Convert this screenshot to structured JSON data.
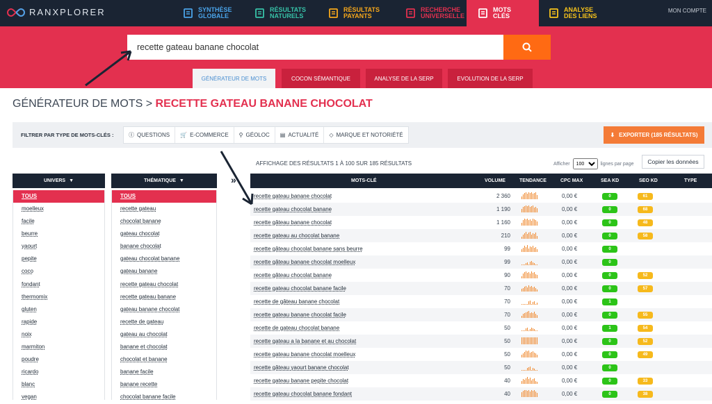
{
  "brand": {
    "name": "RANXPLORER"
  },
  "nav": [
    {
      "label1": "SYNTHÈSE",
      "label2": "GLOBALE",
      "color": "#4aa3e8",
      "icon": "report-icon"
    },
    {
      "label1": "RÉSULTATS",
      "label2": "NATURELS",
      "color": "#37c2a8",
      "icon": "list-icon"
    },
    {
      "label1": "RÉSULTATS",
      "label2": "PAYANTS",
      "color": "#f7a81b",
      "icon": "ad-icon"
    },
    {
      "label1": "RECHERCHE",
      "label2": "UNIVERSELLE",
      "color": "#e3304f",
      "icon": "search-doc-icon"
    },
    {
      "label1": "MOTS",
      "label2": "CLÉS",
      "color": "#ffffff",
      "icon": "key-search-icon",
      "active": true
    },
    {
      "label1": "ANALYSE",
      "label2": "DES LIENS",
      "color": "#f7c31b",
      "icon": "link-icon"
    }
  ],
  "account": "MON COMPTE",
  "search": {
    "value": "recette gateau banane chocolat"
  },
  "tabs": [
    "GÉNÉRATEUR DE MOTS",
    "COCON SÉMANTIQUE",
    "ANALYSE DE LA SERP",
    "EVOLUTION DE LA SERP"
  ],
  "breadcrumb": {
    "root": "GÉNÉRATEUR DE MOTS",
    "separator": " > ",
    "current": "RECETTE GATEAU BANANE CHOCOLAT"
  },
  "filters": {
    "label": "FILTRER PAR TYPE DE MOTS-CLÉS :",
    "chips": [
      "QUESTIONS",
      "E-COMMERCE",
      "GÉOLOC",
      "ACTUALITÉ",
      "MARQUE ET NOTORIÉTÉ"
    ]
  },
  "export_label": "EXPORTER (185 RÉSULTATS)",
  "results_info": "AFFICHAGE DES RÉSULTATS 1 À 100 SUR 185 RÉSULTATS",
  "perpage": {
    "prefix": "Afficher",
    "value": "100",
    "suffix": "lignes par page"
  },
  "copy_label": "Copier les données",
  "univers": {
    "title": "UNIVERS",
    "selected": "TOUS",
    "items": [
      "moelleux",
      "facile",
      "beurre",
      "yaourt",
      "pepite",
      "coco",
      "fondant",
      "thermomix",
      "gluten",
      "rapide",
      "noix",
      "marmiton",
      "poudre",
      "ricardo",
      "blanc",
      "vegan"
    ]
  },
  "thematique": {
    "title": "THÉMATIQUE",
    "selected": "TOUS",
    "items": [
      "recette gateau",
      "chocolat banane",
      "gateau chocolat",
      "banane chocolat",
      "gateau chocolat banane",
      "gateau banane",
      "recette gateau chocolat",
      "recette gateau banane",
      "gateau banane chocolat",
      "recette de gateau",
      "gateau au chocolat",
      "banane et chocolat",
      "chocolat et banane",
      "banane facile",
      "banane recette",
      "chocolat banane facile"
    ]
  },
  "table": {
    "headers": {
      "kw": "MOTS-CLÉ",
      "vol": "VOLUME",
      "trend": "TENDANCE",
      "cpc": "CPC MAX",
      "sea": "SEA KD",
      "seo": "SEO KD",
      "type": "TYPE"
    },
    "rows": [
      {
        "kw": "recette gateau banane chocolat",
        "vol": "2 360",
        "cpc": "0,00 €",
        "sea": "0",
        "seo": "61"
      },
      {
        "kw": "recette gateau chocolat banane",
        "vol": "1 190",
        "cpc": "0,00 €",
        "sea": "0",
        "seo": "68"
      },
      {
        "kw": "recette gâteau banane chocolat",
        "vol": "1 160",
        "cpc": "0,00 €",
        "sea": "0",
        "seo": "48"
      },
      {
        "kw": "recette gateau au chocolat banane",
        "vol": "210",
        "cpc": "0,00 €",
        "sea": "0",
        "seo": "58"
      },
      {
        "kw": "recette gâteau chocolat banane sans beurre",
        "vol": "99",
        "cpc": "0,00 €",
        "sea": "0",
        "seo": ""
      },
      {
        "kw": "recette gâteau banane chocolat moelleux",
        "vol": "99",
        "cpc": "0,00 €",
        "sea": "0",
        "seo": ""
      },
      {
        "kw": "recette gâteau chocolat banane",
        "vol": "90",
        "cpc": "0,00 €",
        "sea": "0",
        "seo": "52"
      },
      {
        "kw": "recette gateau chocolat banane facile",
        "vol": "70",
        "cpc": "0,00 €",
        "sea": "0",
        "seo": "57"
      },
      {
        "kw": "recette de gâteau banane chocolat",
        "vol": "70",
        "cpc": "0,00 €",
        "sea": "1",
        "seo": ""
      },
      {
        "kw": "recette gateau banane chocolat facile",
        "vol": "70",
        "cpc": "0,00 €",
        "sea": "0",
        "seo": "55"
      },
      {
        "kw": "recette de gateau chocolat banane",
        "vol": "50",
        "cpc": "0,00 €",
        "sea": "1",
        "seo": "54"
      },
      {
        "kw": "recette gateau a la banane et au chocolat",
        "vol": "50",
        "cpc": "0,00 €",
        "sea": "0",
        "seo": "52"
      },
      {
        "kw": "recette gateau banane chocolat moelleux",
        "vol": "50",
        "cpc": "0,00 €",
        "sea": "0",
        "seo": "49"
      },
      {
        "kw": "recette gâteau yaourt banane chocolat",
        "vol": "50",
        "cpc": "0,00 €",
        "sea": "0",
        "seo": ""
      },
      {
        "kw": "recette gateau banane pepite chocolat",
        "vol": "40",
        "cpc": "0,00 €",
        "sea": "0",
        "seo": "33"
      },
      {
        "kw": "recette gateau chocolat banane fondant",
        "vol": "40",
        "cpc": "0,00 €",
        "sea": "0",
        "seo": "38"
      }
    ]
  }
}
